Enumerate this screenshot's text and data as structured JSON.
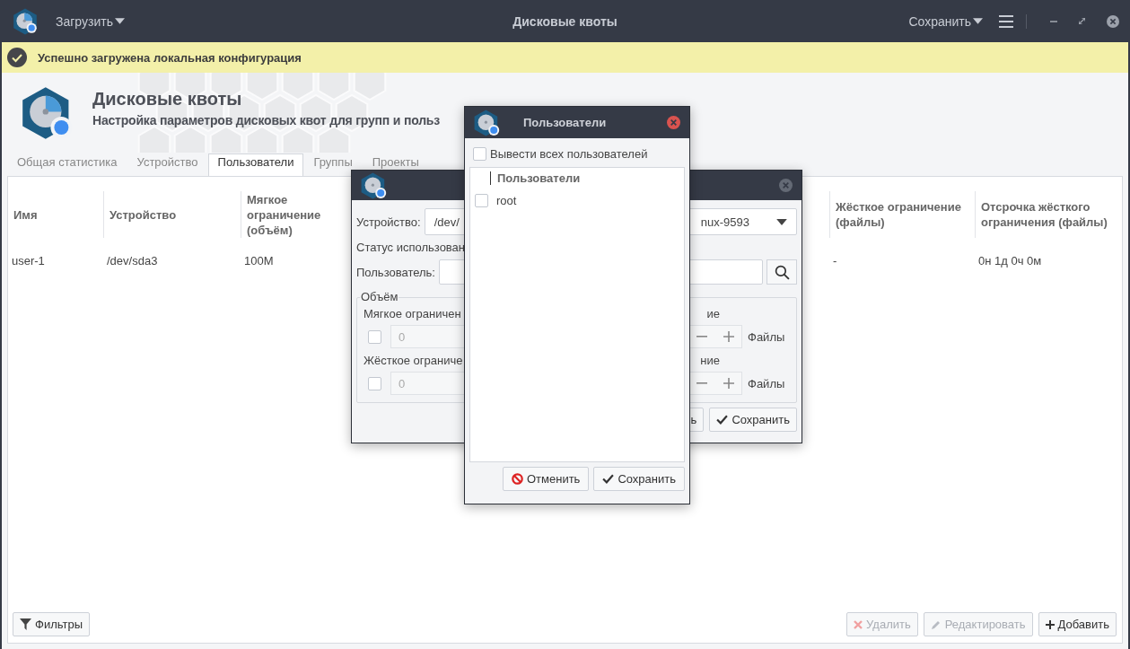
{
  "titlebar": {
    "load_menu": "Загрузить",
    "title": "Дисковые квоты",
    "save_menu": "Сохранить"
  },
  "notification": {
    "text": "Успешно загружена локальная конфигурация"
  },
  "header": {
    "title": "Дисковые квоты",
    "subtitle": "Настройка параметров дисковых квот для групп и польз"
  },
  "tabs": [
    {
      "label": "Общая статистика",
      "selected": false
    },
    {
      "label": "Устройство",
      "selected": false
    },
    {
      "label": "Пользователи",
      "selected": true
    },
    {
      "label": "Группы",
      "selected": false
    },
    {
      "label": "Проекты",
      "selected": false
    }
  ],
  "table": {
    "columns": [
      "Имя",
      "Устройство",
      "Мягкое ограничение (объём)",
      "Жёсткое ограничение (файлы)",
      "Отсрочка жёсткого ограничения (файлы)"
    ],
    "rows": [
      {
        "cells": [
          "user-1",
          "/dev/sda3",
          "100M",
          "-",
          "0н 1д 0ч 0м"
        ]
      }
    ]
  },
  "bottom_bar": {
    "filters": "Фильтры",
    "buttons": [
      {
        "kind": "delete",
        "label": "Удалить",
        "disabled": true
      },
      {
        "kind": "edit",
        "label": "Редактировать",
        "disabled": true
      },
      {
        "kind": "add",
        "label": "Добавить",
        "disabled": false
      }
    ]
  },
  "quota_dialog": {
    "device_label": "Устройство:",
    "device_value_parts": [
      "/dev/",
      "nux-9593"
    ],
    "status_label": "Статус использован",
    "user_label": "Пользователь:",
    "volume_group": {
      "legend": "Объём",
      "rows": [
        {
          "label": "Мягкое ограничен",
          "checked": false,
          "value": "0",
          "files_label": "ие",
          "files_unit": "Файлы"
        },
        {
          "label": "Жёсткое ограниче",
          "checked": false,
          "value": "0",
          "files_label": "ние",
          "files_unit": "Файлы"
        }
      ]
    },
    "buttons": [
      {
        "kind": "cancel",
        "label": "ь"
      },
      {
        "kind": "save",
        "label": "Сохранить"
      }
    ]
  },
  "users_dialog": {
    "title": "Пользователи",
    "show_all": {
      "label": "Вывести всех пользователей",
      "checked": false
    },
    "list_header": "Пользователи",
    "users": [
      {
        "name": "root",
        "checked": false
      }
    ],
    "buttons": [
      {
        "kind": "cancel",
        "label": "Отменить"
      },
      {
        "kind": "save",
        "label": "Сохранить"
      }
    ]
  }
}
